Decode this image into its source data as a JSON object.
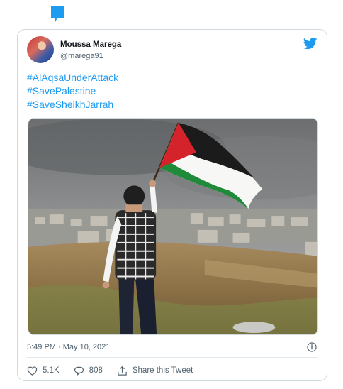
{
  "author": {
    "name": "Moussa Marega",
    "handle": "@marega91"
  },
  "tweet": {
    "hashtags": [
      "#AlAqsaUnderAttack",
      "#SavePalestine",
      "#SaveSheikhJarrah"
    ]
  },
  "timestamp": "5:49 PM · May 10, 2021",
  "actions": {
    "likes": "5.1K",
    "replies": "808",
    "share_label": "Share this Tweet"
  },
  "colors": {
    "link": "#1d9bf0",
    "secondary_text": "#536471",
    "border": "#cfd9de",
    "twitter_blue": "#1d9bf0"
  },
  "icons": [
    "quote-icon",
    "twitter-bird-icon",
    "info-icon",
    "heart-icon",
    "reply-icon",
    "share-icon"
  ]
}
